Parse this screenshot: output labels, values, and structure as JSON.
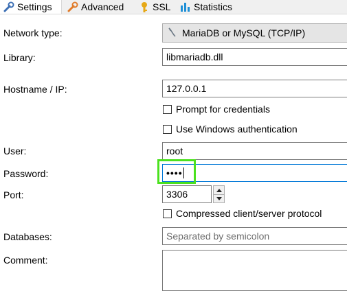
{
  "tabs": [
    {
      "label": "Settings",
      "icon": "wrench-icon",
      "color": "#3c6fb4"
    },
    {
      "label": "Advanced",
      "icon": "wrench-icon",
      "color": "#e07b2a"
    },
    {
      "label": "SSL",
      "icon": "key-icon",
      "color": "#e6a817"
    },
    {
      "label": "Statistics",
      "icon": "bar-chart-icon",
      "color": "#1e8fd6"
    }
  ],
  "form": {
    "network_type": {
      "label": "Network type:",
      "value": "MariaDB or MySQL (TCP/IP)",
      "icon": "dolphin-icon"
    },
    "library": {
      "label": "Library:",
      "value": "libmariadb.dll"
    },
    "hostname": {
      "label": "Hostname / IP:",
      "value": "127.0.0.1"
    },
    "prompt_credentials": {
      "label": "Prompt for credentials",
      "checked": false
    },
    "windows_auth": {
      "label": "Use Windows authentication",
      "checked": false
    },
    "user": {
      "label": "User:",
      "value": "root"
    },
    "password": {
      "label": "Password:",
      "value": "••••"
    },
    "port": {
      "label": "Port:",
      "value": "3306"
    },
    "compressed": {
      "label": "Compressed client/server protocol",
      "checked": false
    },
    "databases": {
      "label": "Databases:",
      "placeholder": "Separated by semicolon",
      "value": ""
    },
    "comment": {
      "label": "Comment:",
      "value": ""
    }
  },
  "highlight_color": "#4be11e",
  "focus_color": "#0078d7"
}
